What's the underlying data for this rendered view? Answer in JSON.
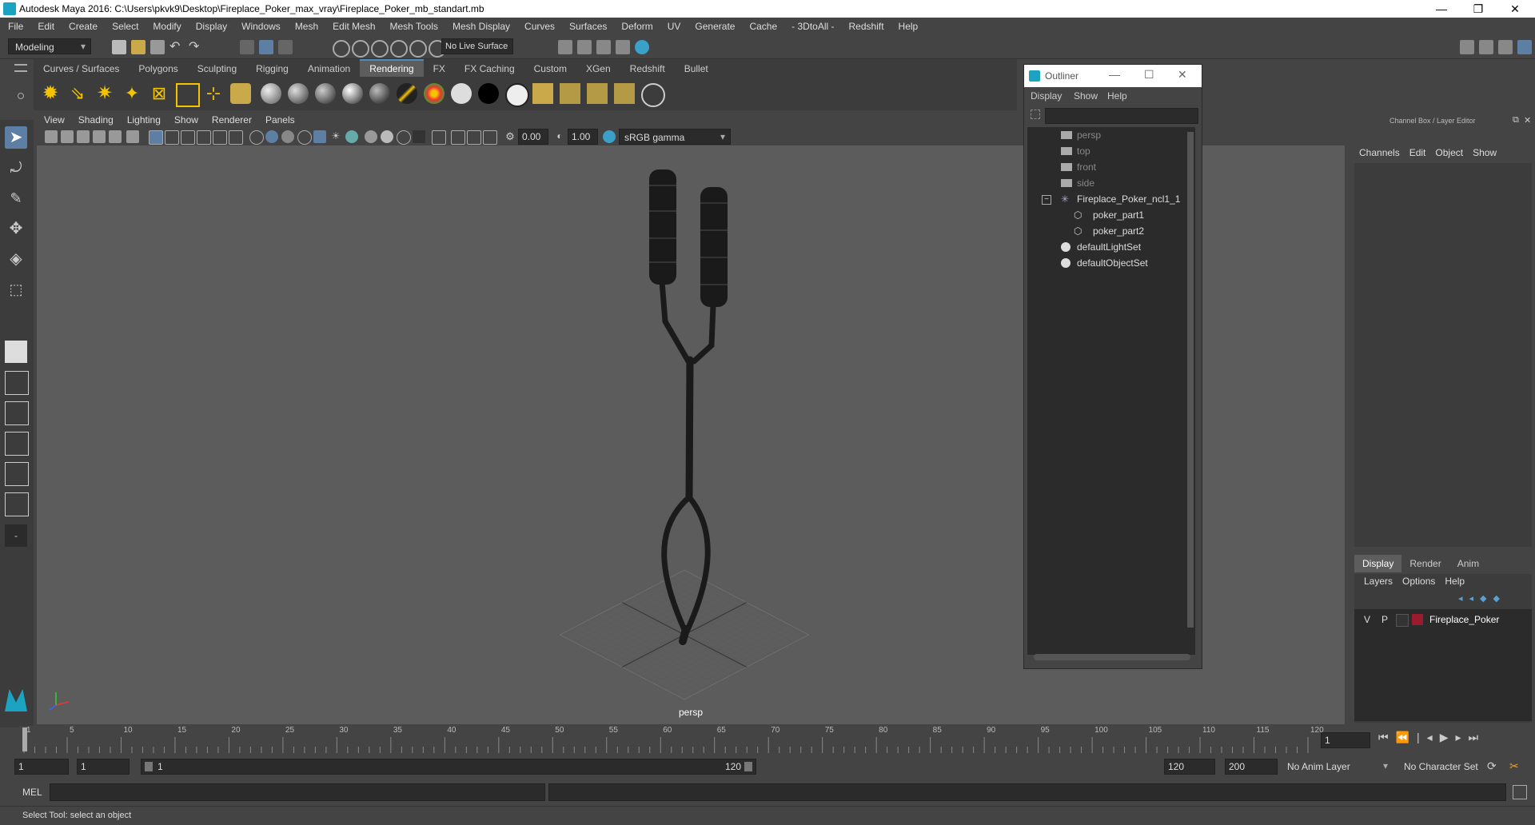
{
  "window": {
    "title": "Autodesk Maya 2016: C:\\Users\\pkvk9\\Desktop\\Fireplace_Poker_max_vray\\Fireplace_Poker_mb_standart.mb",
    "controls": [
      "—",
      "❐",
      "✕"
    ]
  },
  "menubar": [
    "File",
    "Edit",
    "Create",
    "Select",
    "Modify",
    "Display",
    "Windows",
    "Mesh",
    "Edit Mesh",
    "Mesh Tools",
    "Mesh Display",
    "Curves",
    "Surfaces",
    "Deform",
    "UV",
    "Generate",
    "Cache",
    "- 3DtoAll -",
    "Redshift",
    "Help"
  ],
  "statusline": {
    "mode": "Modeling",
    "live_surface": "No Live Surface"
  },
  "shelf": {
    "tabs": [
      "Curves / Surfaces",
      "Polygons",
      "Sculpting",
      "Rigging",
      "Animation",
      "Rendering",
      "FX",
      "FX Caching",
      "Custom",
      "XGen",
      "Redshift",
      "Bullet"
    ],
    "active_tab": "Rendering"
  },
  "viewport": {
    "menus": [
      "View",
      "Shading",
      "Lighting",
      "Show",
      "Renderer",
      "Panels"
    ],
    "exposure": "0.00",
    "gamma": "1.00",
    "color_space": "sRGB gamma",
    "camera_label": "persp"
  },
  "outliner": {
    "title": "Outliner",
    "menus": [
      "Display",
      "Show",
      "Help"
    ],
    "items": [
      {
        "label": "persp",
        "dim": true,
        "indent": 0,
        "icon": "camera-icon"
      },
      {
        "label": "top",
        "dim": true,
        "indent": 0,
        "icon": "camera-icon"
      },
      {
        "label": "front",
        "dim": true,
        "indent": 0,
        "icon": "camera-icon"
      },
      {
        "label": "side",
        "dim": true,
        "indent": 0,
        "icon": "camera-icon"
      },
      {
        "label": "Fireplace_Poker_ncl1_1",
        "dim": false,
        "indent": 0,
        "icon": "group-icon"
      },
      {
        "label": "poker_part1",
        "dim": false,
        "indent": 1,
        "icon": "mesh-icon"
      },
      {
        "label": "poker_part2",
        "dim": false,
        "indent": 1,
        "icon": "mesh-icon"
      },
      {
        "label": "defaultLightSet",
        "dim": false,
        "indent": 0,
        "icon": "set-icon"
      },
      {
        "label": "defaultObjectSet",
        "dim": false,
        "indent": 0,
        "icon": "set-icon"
      }
    ]
  },
  "channelbox": {
    "header": "Channel Box / Layer Editor",
    "menus": [
      "Channels",
      "Edit",
      "Object",
      "Show"
    ],
    "layer_tabs": [
      "Display",
      "Render",
      "Anim"
    ],
    "layer_menus": [
      "Layers",
      "Options",
      "Help"
    ],
    "layer": {
      "v": "V",
      "p": "P",
      "name": "Fireplace_Poker",
      "color": "#9b1b2e"
    }
  },
  "timeline": {
    "ticks": [
      "1",
      "5",
      "10",
      "15",
      "20",
      "25",
      "30",
      "35",
      "40",
      "45",
      "50",
      "55",
      "60",
      "65",
      "70",
      "75",
      "80",
      "85",
      "90",
      "95",
      "100",
      "105",
      "110",
      "115",
      "120"
    ],
    "current_frame": "1"
  },
  "range": {
    "start": "1",
    "playback_start": "1",
    "slider_start": "1",
    "slider_end": "120",
    "playback_end": "120",
    "end": "200",
    "anim_layer": "No Anim Layer",
    "character_set": "No Character Set"
  },
  "cmdline": {
    "label": "MEL"
  },
  "helpline": {
    "text": "Select Tool: select an object"
  },
  "colors": {
    "accent": "#4a8fbd",
    "brand": "#1da3c2"
  }
}
